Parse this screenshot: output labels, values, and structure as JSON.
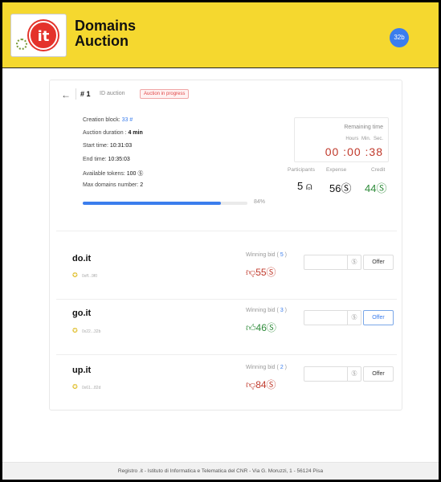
{
  "app": {
    "title_line1": "Domains",
    "title_line2": "Auction",
    "logo_text": "it",
    "user_badge": "32b"
  },
  "auction": {
    "number": "# 1",
    "id_label": "ID auction",
    "status": "Auction in progress",
    "creation_block_label": "Creation block:",
    "creation_block_value": "33 #",
    "duration_label": "Auction duration :",
    "duration_value": "4 min",
    "start_label": "Start time:",
    "start_value": "10:31:03",
    "end_label": "End time:",
    "end_value": "10:35:03",
    "tokens_label": "Available tokens:",
    "tokens_value": "100 Ⓢ",
    "max_domains_label": "Max domains number:",
    "max_domains_value": "2",
    "progress_percent": 84,
    "progress_text": "84%"
  },
  "remaining": {
    "title": "Remaining time",
    "units": "Hours Min. Sec.",
    "clock": "00 :00 :38"
  },
  "stats": {
    "participants_label": "Participants",
    "expense_label": "Expense",
    "credit_label": "Credit",
    "participants_value": "5 ⍝",
    "expense_value": "56Ⓢ",
    "credit_value": "44Ⓢ",
    "credit_color": "#2e8b3a"
  },
  "domains": [
    {
      "name": "do.it",
      "owner": "0xff...9f0",
      "winning_label": "Winning bid (",
      "count": "5",
      "bid": "55Ⓢ",
      "thumb": "down",
      "offer": "Offer"
    },
    {
      "name": "go.it",
      "owner": "0x22...32b",
      "winning_label": "Winning bid (",
      "count": "3",
      "bid": "46Ⓢ",
      "thumb": "up",
      "offer": "Offer"
    },
    {
      "name": "up.it",
      "owner": "0x61...82d",
      "winning_label": "Winning bid (",
      "count": "2",
      "bid": "84Ⓢ",
      "thumb": "down",
      "offer": "Offer"
    }
  ],
  "currency_symbol": "Ⓢ",
  "colors": {
    "brand_yellow": "#f5d82f",
    "accent_blue": "#3b7ded",
    "losing_red": "#c0392b",
    "winning_green": "#2e8b3a"
  },
  "footer": "Registro .it - Istituto di Informatica e Telematica del CNR - Via G. Moruzzi, 1 - 56124 Pisa"
}
